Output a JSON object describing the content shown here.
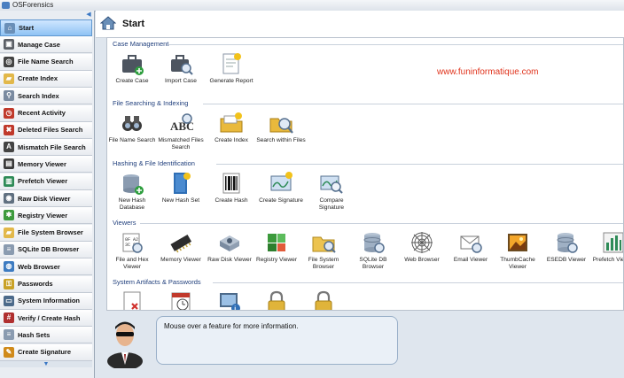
{
  "window": {
    "title": "OSForensics"
  },
  "header": {
    "title": "Start"
  },
  "watermark": "www.funinformatique.com",
  "info": {
    "text": "Mouse over a feature for more information."
  },
  "sidebar": {
    "items": [
      {
        "label": "Start",
        "icon": "house-icon"
      },
      {
        "label": "Manage Case",
        "icon": "briefcase-icon"
      },
      {
        "label": "File Name Search",
        "icon": "binoculars-icon"
      },
      {
        "label": "Create Index",
        "icon": "folder-icon"
      },
      {
        "label": "Search Index",
        "icon": "magnifier-icon"
      },
      {
        "label": "Recent Activity",
        "icon": "clock-icon"
      },
      {
        "label": "Deleted Files Search",
        "icon": "trash-icon"
      },
      {
        "label": "Mismatch File Search",
        "icon": "abc-icon"
      },
      {
        "label": "Memory Viewer",
        "icon": "memory-icon"
      },
      {
        "label": "Prefetch Viewer",
        "icon": "prefetch-icon"
      },
      {
        "label": "Raw Disk Viewer",
        "icon": "disk-icon"
      },
      {
        "label": "Registry Viewer",
        "icon": "registry-icon"
      },
      {
        "label": "File System Browser",
        "icon": "folder-icon"
      },
      {
        "label": "SQLite DB Browser",
        "icon": "database-icon"
      },
      {
        "label": "Web Browser",
        "icon": "globe-icon"
      },
      {
        "label": "Passwords",
        "icon": "key-icon"
      },
      {
        "label": "System Information",
        "icon": "computer-icon"
      },
      {
        "label": "Verify / Create Hash",
        "icon": "hash-icon"
      },
      {
        "label": "Hash Sets",
        "icon": "database-icon"
      },
      {
        "label": "Create Signature",
        "icon": "signature-icon"
      }
    ]
  },
  "sections": [
    {
      "title": "Case Management",
      "tiles": [
        {
          "label": "Create Case",
          "icon": "create-case-icon"
        },
        {
          "label": "Import Case",
          "icon": "import-case-icon"
        },
        {
          "label": "Generate Report",
          "icon": "report-icon"
        }
      ]
    },
    {
      "title": "File Searching & Indexing",
      "tiles": [
        {
          "label": "File Name Search",
          "icon": "binoculars-icon"
        },
        {
          "label": "Mismatched Files Search",
          "icon": "abc-icon"
        },
        {
          "label": "Create Index",
          "icon": "create-index-icon"
        },
        {
          "label": "Search within Files",
          "icon": "search-files-icon"
        }
      ]
    },
    {
      "title": "Hashing & File Identification",
      "tiles": [
        {
          "label": "New Hash Database",
          "icon": "hash-db-icon"
        },
        {
          "label": "New Hash Set",
          "icon": "hash-set-icon"
        },
        {
          "label": "Create Hash",
          "icon": "barcode-icon"
        },
        {
          "label": "Create Signature",
          "icon": "signature-icon"
        },
        {
          "label": "Compare Signature",
          "icon": "compare-icon"
        }
      ]
    },
    {
      "title": "Viewers",
      "tiles": [
        {
          "label": "File and Hex Viewer",
          "icon": "hex-viewer-icon"
        },
        {
          "label": "Memory Viewer",
          "icon": "memory-icon"
        },
        {
          "label": "Raw Disk Viewer",
          "icon": "disk-icon"
        },
        {
          "label": "Registry Viewer",
          "icon": "registry-icon"
        },
        {
          "label": "File System Browser",
          "icon": "folder-icon"
        },
        {
          "label": "SQLite DB Browser",
          "icon": "database-icon"
        },
        {
          "label": "Web Browser",
          "icon": "spider-web-icon"
        },
        {
          "label": "Email Viewer",
          "icon": "email-icon"
        },
        {
          "label": "ThumbCache Viewer",
          "icon": "picture-icon"
        },
        {
          "label": "ESEDB Viewer",
          "icon": "database-icon"
        },
        {
          "label": "Prefetch Viewer",
          "icon": "prefetch-icon"
        }
      ]
    },
    {
      "title": "System Artifacts & Passwords",
      "tiles": [
        {
          "label": "",
          "icon": "checklist-icon"
        },
        {
          "label": "",
          "icon": "calendar-icon"
        },
        {
          "label": "",
          "icon": "system-info-icon"
        },
        {
          "label": "",
          "icon": "padlock-icon"
        },
        {
          "label": "",
          "icon": "padlock-icon"
        }
      ]
    }
  ]
}
